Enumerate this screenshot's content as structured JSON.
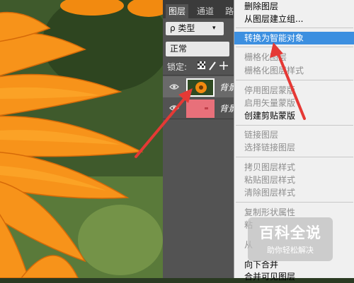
{
  "panel": {
    "tabs": [
      {
        "label": "图层"
      },
      {
        "label": "通道"
      },
      {
        "label": "路"
      }
    ],
    "filter_label": "ρ 类型",
    "blend_mode": "正常",
    "lock_label": "锁定:",
    "layers": [
      {
        "name": "背景"
      },
      {
        "name": "背景"
      }
    ]
  },
  "menu": {
    "items": [
      {
        "label": "删除图层",
        "enabled": true
      },
      {
        "label": "从图层建立组...",
        "enabled": true
      },
      {
        "label": "转换为智能对象",
        "enabled": true,
        "highlighted": true
      },
      {
        "label": "栅格化图层",
        "enabled": false
      },
      {
        "label": "栅格化图层样式",
        "enabled": false
      },
      {
        "label": "停用图层蒙版",
        "enabled": false
      },
      {
        "label": "启用矢量蒙版",
        "enabled": false
      },
      {
        "label": "创建剪贴蒙版",
        "enabled": true
      },
      {
        "label": "链接图层",
        "enabled": false
      },
      {
        "label": "选择链接图层",
        "enabled": false
      },
      {
        "label": "拷贝图层样式",
        "enabled": false
      },
      {
        "label": "粘贴图层样式",
        "enabled": false
      },
      {
        "label": "清除图层样式",
        "enabled": false
      },
      {
        "label": "复制形状属性",
        "enabled": false
      },
      {
        "label": "粘",
        "enabled": false
      },
      {
        "label": "从",
        "enabled": false
      },
      {
        "label": "向下合并",
        "enabled": true
      },
      {
        "label": "合并可见图层",
        "enabled": true
      }
    ]
  },
  "watermark": {
    "title": "百科全说",
    "subtitle": "助你轻松解决"
  },
  "colors": {
    "highlight": "#3c8fe0",
    "arrow": "#e53935",
    "layer_thumb_pink": "#e8707a"
  }
}
